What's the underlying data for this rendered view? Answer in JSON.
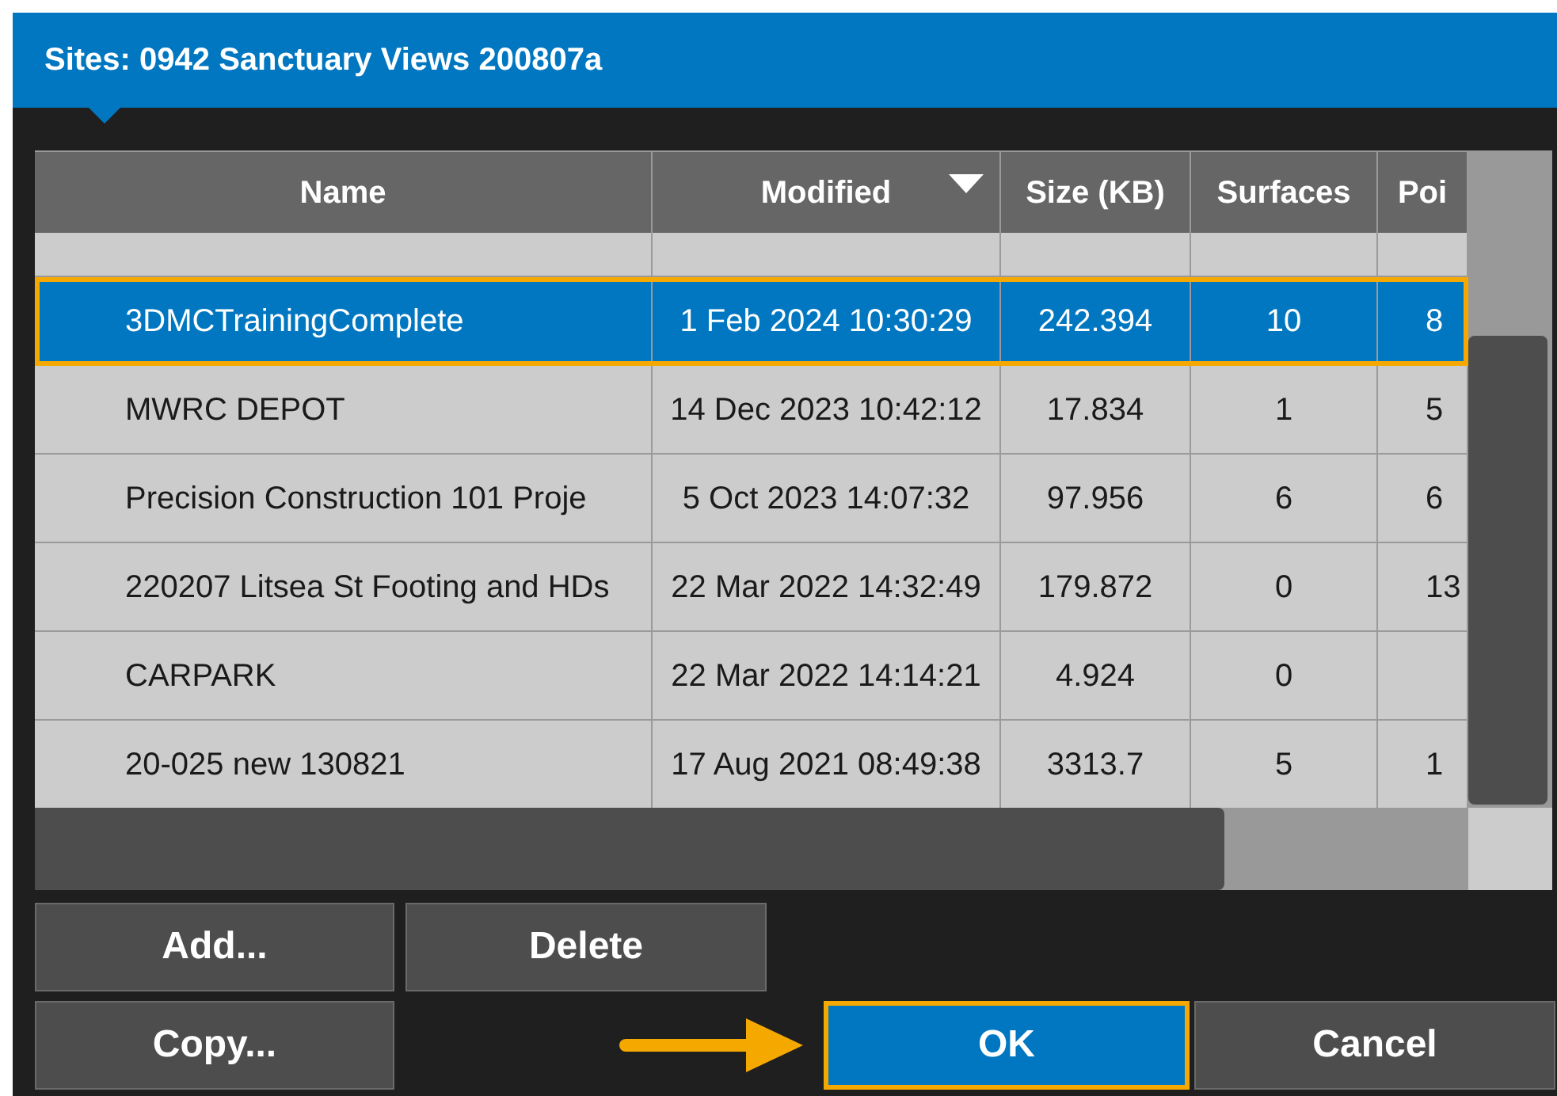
{
  "window": {
    "title": "Sites: 0942 Sanctuary Views 200807a"
  },
  "table": {
    "columns": [
      {
        "label": "Name",
        "sorted": false
      },
      {
        "label": "Modified",
        "sorted": true
      },
      {
        "label": "Size (KB)",
        "sorted": false
      },
      {
        "label": "Surfaces",
        "sorted": false
      },
      {
        "label": "Poi",
        "sorted": false
      }
    ],
    "rows": [
      {
        "cells": [
          "3DMCTrainingComplete",
          "1 Feb 2024 10:30:29",
          "242.394",
          "10",
          "8"
        ],
        "selected": true,
        "highlighted": true
      },
      {
        "cells": [
          "MWRC DEPOT",
          "14 Dec 2023 10:42:12",
          "17.834",
          "1",
          "5"
        ],
        "selected": false,
        "highlighted": false
      },
      {
        "cells": [
          "Precision Construction 101 Proje",
          "5 Oct 2023 14:07:32",
          "97.956",
          "6",
          "6"
        ],
        "selected": false,
        "highlighted": false
      },
      {
        "cells": [
          "220207 Litsea St Footing and HDs",
          "22 Mar 2022 14:32:49",
          "179.872",
          "0",
          "13"
        ],
        "selected": false,
        "highlighted": false
      },
      {
        "cells": [
          "CARPARK",
          "22 Mar 2022 14:14:21",
          "4.924",
          "0"
        ],
        "selected": false,
        "highlighted": false
      },
      {
        "cells": [
          "20-025 new 130821",
          "17 Aug 2021 08:49:38",
          "3313.7",
          "5",
          "1"
        ],
        "selected": false,
        "highlighted": false
      }
    ]
  },
  "buttons": [
    {
      "label": "Add...",
      "kind": "normal",
      "highlighted": false
    },
    {
      "label": "Delete",
      "kind": "normal",
      "highlighted": false
    },
    {
      "label": "Copy...",
      "kind": "normal",
      "highlighted": false
    },
    {
      "label": "OK",
      "kind": "primary",
      "highlighted": true
    },
    {
      "label": "Cancel",
      "kind": "normal",
      "highlighted": false
    }
  ]
}
